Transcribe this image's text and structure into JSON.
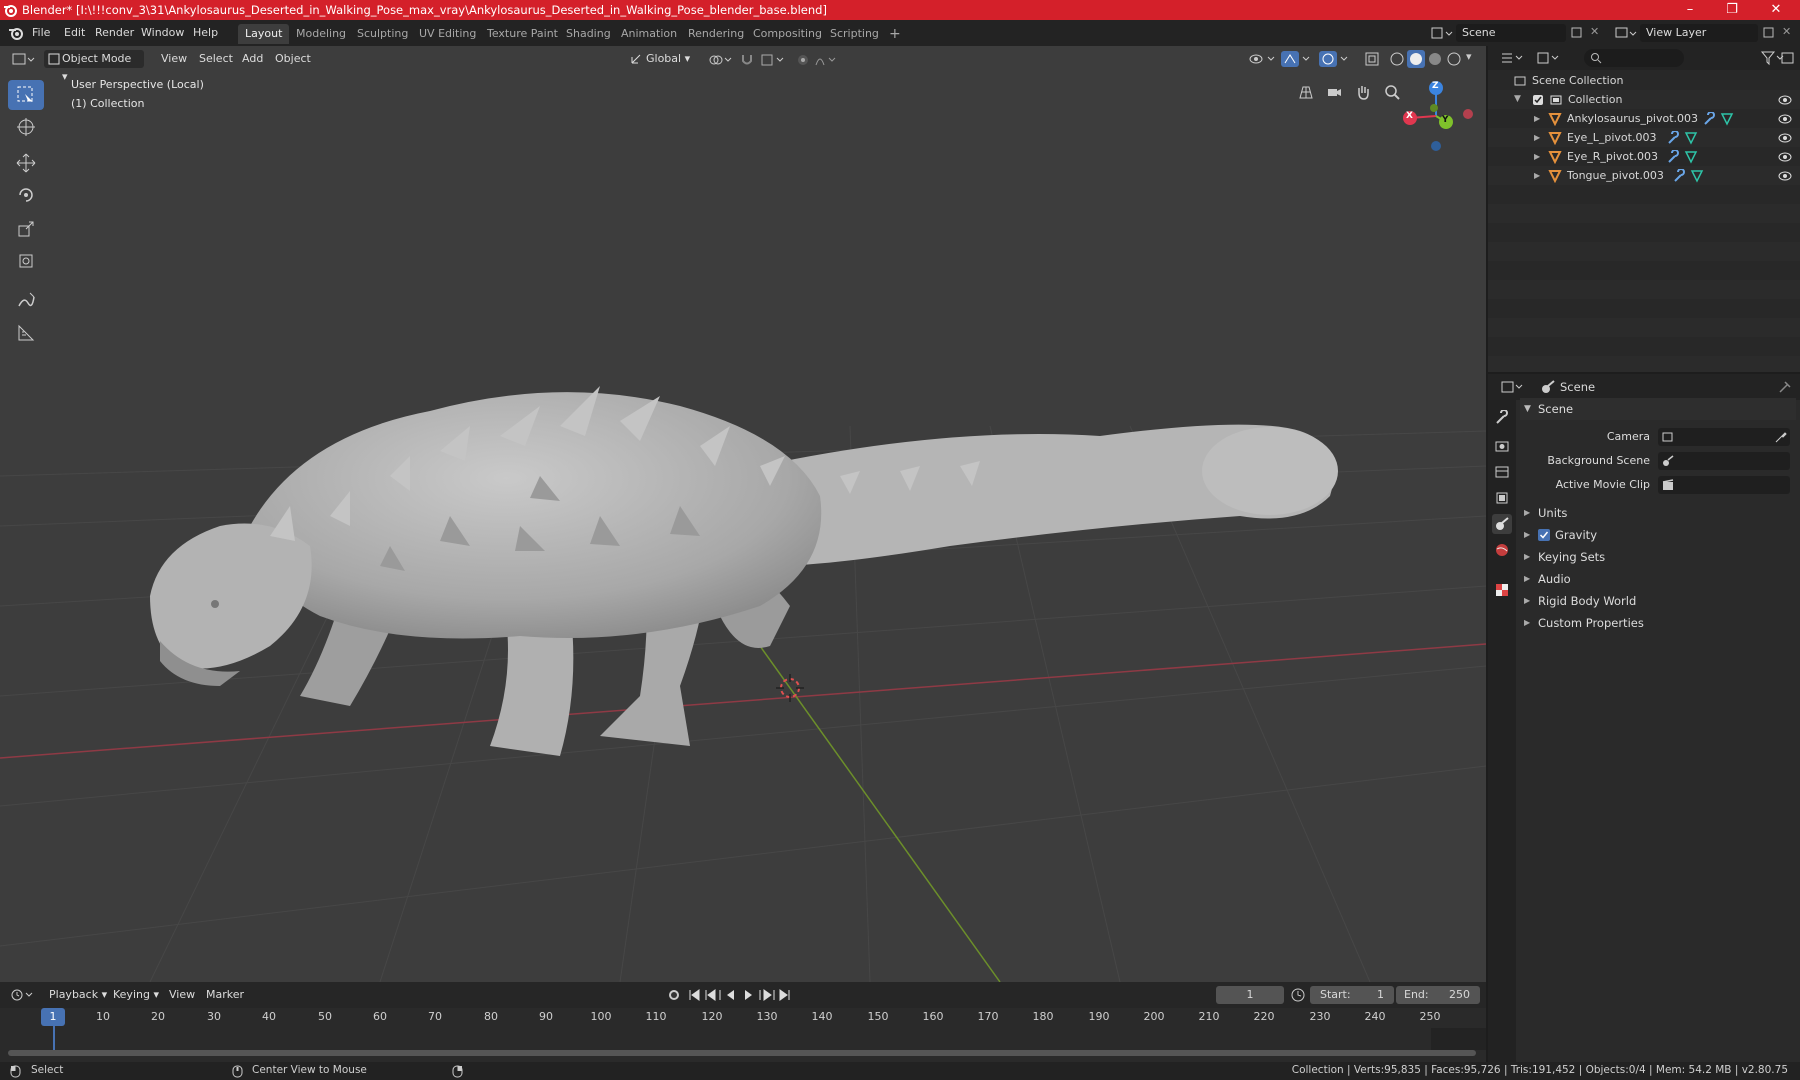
{
  "titlebar": {
    "title": "Blender* [I:\\!!!conv_3\\31\\Ankylosaurus_Deserted_in_Walking_Pose_max_vray\\Ankylosaurus_Deserted_in_Walking_Pose_blender_base.blend]",
    "minimize": "–",
    "maximize": "❐",
    "close": "✕"
  },
  "menu": {
    "items": [
      "File",
      "Edit",
      "Render",
      "Window",
      "Help"
    ],
    "workspaces": [
      "Layout",
      "Modeling",
      "Sculpting",
      "UV Editing",
      "Texture Paint",
      "Shading",
      "Animation",
      "Rendering",
      "Compositing",
      "Scripting"
    ],
    "active_workspace": "Layout",
    "add_tab": "+",
    "scene_value": "Scene",
    "view_layer_value": "View Layer"
  },
  "viewport_header": {
    "mode": "Object Mode",
    "menus": [
      "View",
      "Select",
      "Add",
      "Object"
    ],
    "orientation": "Global"
  },
  "viewport": {
    "perspective_label": "User Perspective (Local)",
    "collection_label": "(1) Collection",
    "gizmo": {
      "x": "X",
      "y": "Y",
      "z": "Z"
    }
  },
  "outliner": {
    "root": "Scene Collection",
    "collection": "Collection",
    "objects": [
      "Ankylosaurus_pivot.003",
      "Eye_L_pivot.003",
      "Eye_R_pivot.003",
      "Tongue_pivot.003"
    ]
  },
  "properties": {
    "context_title": "Scene",
    "panel_title": "Scene",
    "fields": [
      {
        "label": "Camera"
      },
      {
        "label": "Background Scene"
      },
      {
        "label": "Active Movie Clip"
      }
    ],
    "sections": [
      "Units",
      "Gravity",
      "Keying Sets",
      "Audio",
      "Rigid Body World",
      "Custom Properties"
    ]
  },
  "timeline": {
    "menus": [
      "Playback",
      "Keying",
      "View",
      "Marker"
    ],
    "current_frame": "1",
    "start_label": "Start:",
    "start_value": "1",
    "end_label": "End:",
    "end_value": "250",
    "ticks": [
      "1",
      "10",
      "20",
      "30",
      "40",
      "50",
      "60",
      "70",
      "80",
      "90",
      "100",
      "110",
      "120",
      "130",
      "140",
      "150",
      "160",
      "170",
      "180",
      "190",
      "200",
      "210",
      "220",
      "230",
      "240",
      "250"
    ]
  },
  "statusbar": {
    "left": "Select",
    "middle": "Center View to Mouse",
    "right": "Collection | Verts:95,835 | Faces:95,726 | Tris:191,452 | Objects:0/4 | Mem: 54.2 MB | v2.80.75"
  },
  "colors": {
    "titlebar": "#d4202a",
    "accent": "#4772b3",
    "x_axis": "#e0374f",
    "y_axis": "#7fc12b",
    "z_axis": "#3b84e0",
    "object_icon": "#e5913c",
    "modifier_icon": "#6aa6e8",
    "mesh_icon": "#2ec4a8"
  }
}
